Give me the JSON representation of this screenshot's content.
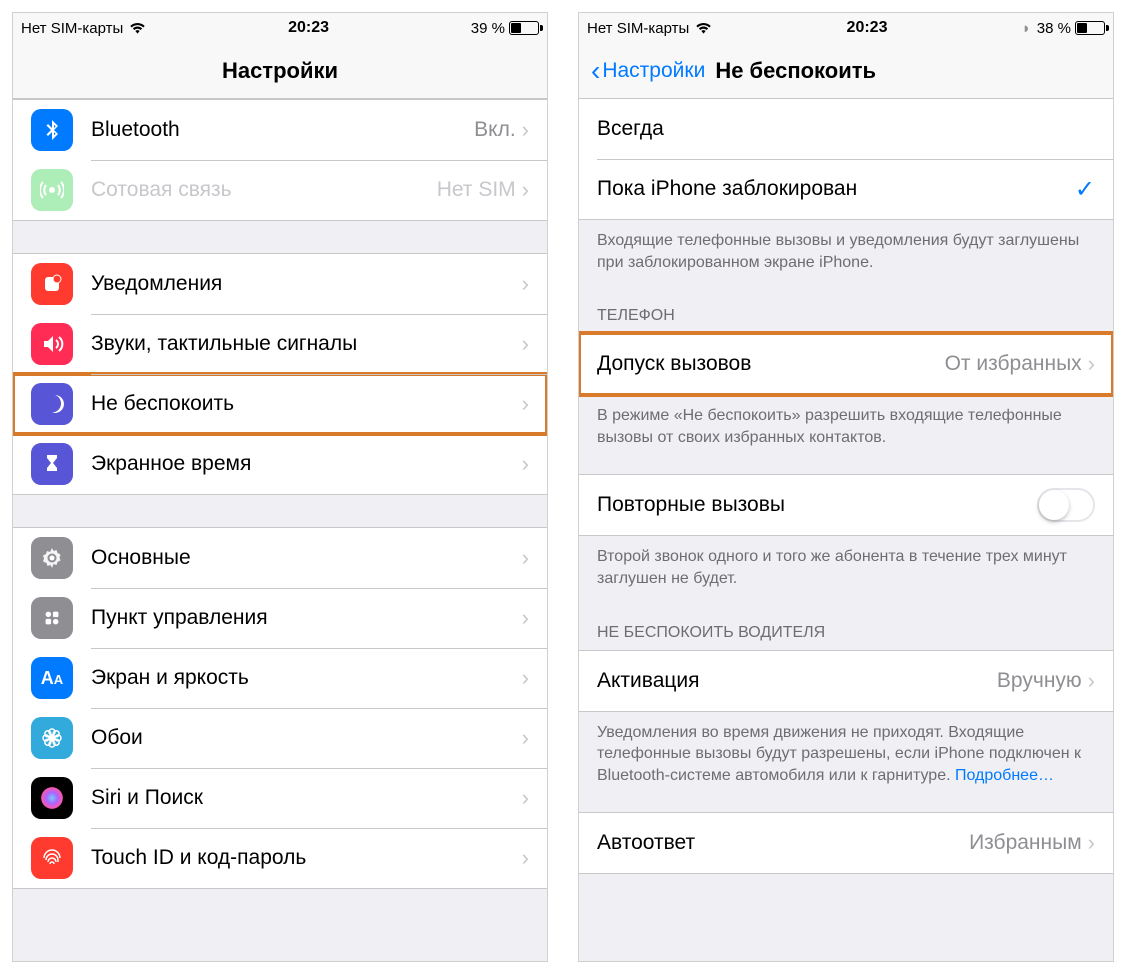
{
  "phone1": {
    "status": {
      "carrier": "Нет SIM-карты",
      "time": "20:23",
      "battery_pct": "39 %",
      "battery_fill": 39
    },
    "nav": {
      "title": "Настройки"
    },
    "group1": [
      {
        "id": "bluetooth",
        "icon_bg": "#007aff",
        "icon": "bluetooth",
        "label": "Bluetooth",
        "value": "Вкл.",
        "disabled": false,
        "chevron": true
      },
      {
        "id": "cellular",
        "icon_bg": "#4cd964",
        "icon": "cellular",
        "label": "Сотовая связь",
        "value": "Нет SIM",
        "disabled": true,
        "chevron": true
      }
    ],
    "group2": [
      {
        "id": "notifications",
        "icon_bg": "#ff3b30",
        "icon": "notifications",
        "label": "Уведомления",
        "chevron": true
      },
      {
        "id": "sounds",
        "icon_bg": "#ff2d55",
        "icon": "sounds",
        "label": "Звуки, тактильные сигналы",
        "chevron": true
      },
      {
        "id": "dnd",
        "icon_bg": "#5856d6",
        "icon": "moon",
        "label": "Не беспокоить",
        "chevron": true,
        "highlight": true
      },
      {
        "id": "screentime",
        "icon_bg": "#5856d6",
        "icon": "hourglass",
        "label": "Экранное время",
        "chevron": true
      }
    ],
    "group3": [
      {
        "id": "general",
        "icon_bg": "#8e8e93",
        "icon": "gear",
        "label": "Основные",
        "chevron": true
      },
      {
        "id": "control-center",
        "icon_bg": "#8e8e93",
        "icon": "control",
        "label": "Пункт управления",
        "chevron": true
      },
      {
        "id": "display",
        "icon_bg": "#007aff",
        "icon": "aa",
        "label": "Экран и яркость",
        "chevron": true
      },
      {
        "id": "wallpaper",
        "icon_bg": "#32aadc",
        "icon": "flower",
        "label": "Обои",
        "chevron": true
      },
      {
        "id": "siri",
        "icon_bg": "#000",
        "icon": "siri",
        "label": "Siri и Поиск",
        "chevron": true
      },
      {
        "id": "touchid",
        "icon_bg": "#ff3b30",
        "icon": "fingerprint",
        "label": "Touch ID и код-пароль",
        "chevron": true
      }
    ]
  },
  "phone2": {
    "status": {
      "carrier": "Нет SIM-карты",
      "time": "20:23",
      "battery_pct": "38 %",
      "battery_fill": 38,
      "dnd_active": true
    },
    "nav": {
      "back": "Настройки",
      "title": "Не беспокоить"
    },
    "silence_group": {
      "rows": [
        {
          "id": "always",
          "label": "Всегда",
          "checked": false
        },
        {
          "id": "while-locked",
          "label": "Пока iPhone заблокирован",
          "checked": true
        }
      ],
      "footer": "Входящие телефонные вызовы и уведомления будут заглушены при заблокированном экране iPhone."
    },
    "phone_section": {
      "header": "ТЕЛЕФОН",
      "allow_calls": {
        "label": "Допуск вызовов",
        "value": "От избранных",
        "highlight": true
      },
      "allow_footer": "В режиме «Не беспокоить» разрешить входящие телефонные вызовы от своих избранных контактов.",
      "repeat_calls": {
        "label": "Повторные вызовы",
        "on": false
      },
      "repeat_footer": "Второй звонок одного и того же абонента в течение трех минут заглушен не будет."
    },
    "driving_section": {
      "header": "НЕ БЕСПОКОИТЬ ВОДИТЕЛЯ",
      "activate": {
        "label": "Активация",
        "value": "Вручную"
      },
      "footer_text": "Уведомления во время движения не приходят. Входящие телефонные вызовы будут разрешены, если iPhone подключен к Bluetooth-системе автомобиля или к гарнитуре. ",
      "footer_link": "Подробнее…",
      "autoreply": {
        "label": "Автоответ",
        "value": "Избранным"
      }
    }
  }
}
